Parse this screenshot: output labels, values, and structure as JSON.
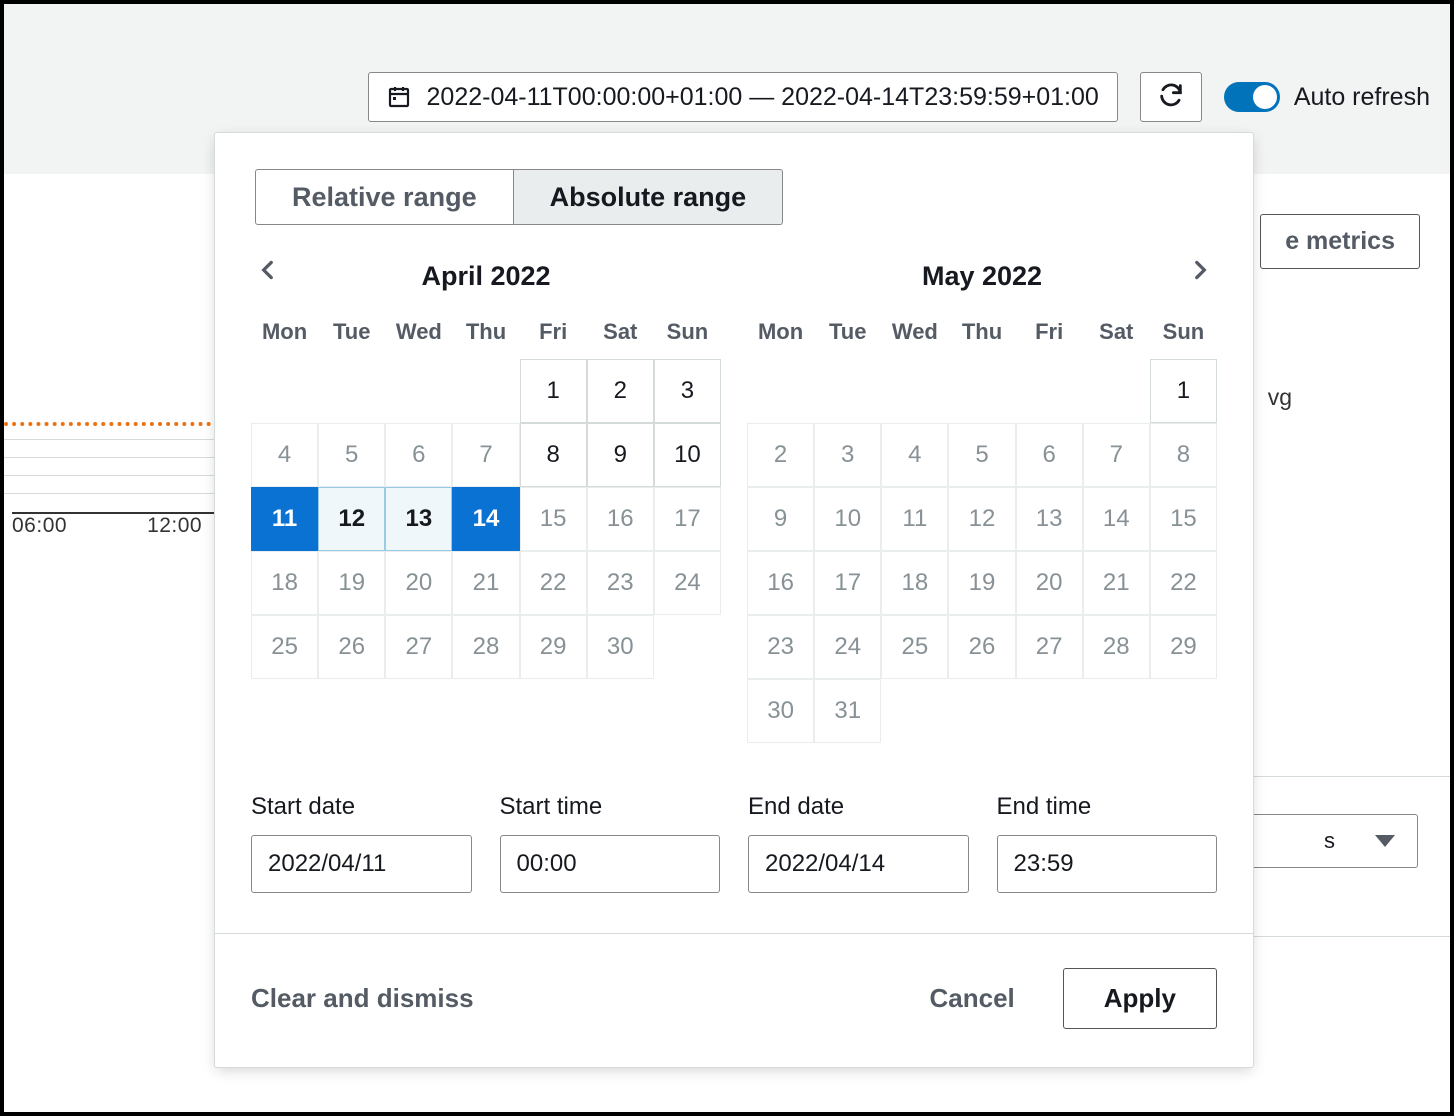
{
  "toolbar": {
    "range_text": "2022-04-11T00:00:00+01:00 — 2022-04-14T23:59:59+01:00",
    "auto_refresh_label": "Auto refresh",
    "auto_refresh_on": true
  },
  "background": {
    "metrics_button_partial_text": "e metrics",
    "chart_label_partial": "vg",
    "x_ticks": [
      "06:00",
      "12:00"
    ]
  },
  "popover": {
    "tabs": {
      "relative": "Relative range",
      "absolute": "Absolute range",
      "active": "absolute"
    },
    "months": [
      {
        "title": "April 2022",
        "weekdays": [
          "Mon",
          "Tue",
          "Wed",
          "Thu",
          "Fri",
          "Sat",
          "Sun"
        ],
        "leading_empty": 4,
        "days": [
          {
            "n": 1,
            "state": "boundary"
          },
          {
            "n": 2,
            "state": "boundary"
          },
          {
            "n": 3,
            "state": "boundary"
          },
          {
            "n": 4,
            "state": "dim"
          },
          {
            "n": 5,
            "state": "dim"
          },
          {
            "n": 6,
            "state": "dim"
          },
          {
            "n": 7,
            "state": "dim"
          },
          {
            "n": 8,
            "state": "boundary"
          },
          {
            "n": 9,
            "state": "boundary"
          },
          {
            "n": 10,
            "state": "boundary"
          },
          {
            "n": 11,
            "state": "sel-start"
          },
          {
            "n": 12,
            "state": "sel-range"
          },
          {
            "n": 13,
            "state": "sel-range"
          },
          {
            "n": 14,
            "state": "sel-end"
          },
          {
            "n": 15,
            "state": "dim"
          },
          {
            "n": 16,
            "state": "dim"
          },
          {
            "n": 17,
            "state": "dim"
          },
          {
            "n": 18,
            "state": "dim"
          },
          {
            "n": 19,
            "state": "dim"
          },
          {
            "n": 20,
            "state": "dim"
          },
          {
            "n": 21,
            "state": "dim"
          },
          {
            "n": 22,
            "state": "dim"
          },
          {
            "n": 23,
            "state": "dim"
          },
          {
            "n": 24,
            "state": "dim"
          },
          {
            "n": 25,
            "state": "dim"
          },
          {
            "n": 26,
            "state": "dim"
          },
          {
            "n": 27,
            "state": "dim"
          },
          {
            "n": 28,
            "state": "dim"
          },
          {
            "n": 29,
            "state": "dim"
          },
          {
            "n": 30,
            "state": "dim"
          }
        ]
      },
      {
        "title": "May 2022",
        "weekdays": [
          "Mon",
          "Tue",
          "Wed",
          "Thu",
          "Fri",
          "Sat",
          "Sun"
        ],
        "leading_empty": 6,
        "days": [
          {
            "n": 1,
            "state": "boundary"
          },
          {
            "n": 2,
            "state": "dim"
          },
          {
            "n": 3,
            "state": "dim"
          },
          {
            "n": 4,
            "state": "dim"
          },
          {
            "n": 5,
            "state": "dim"
          },
          {
            "n": 6,
            "state": "dim"
          },
          {
            "n": 7,
            "state": "dim"
          },
          {
            "n": 8,
            "state": "dim"
          },
          {
            "n": 9,
            "state": "dim"
          },
          {
            "n": 10,
            "state": "dim"
          },
          {
            "n": 11,
            "state": "dim"
          },
          {
            "n": 12,
            "state": "dim"
          },
          {
            "n": 13,
            "state": "dim"
          },
          {
            "n": 14,
            "state": "dim"
          },
          {
            "n": 15,
            "state": "dim"
          },
          {
            "n": 16,
            "state": "dim"
          },
          {
            "n": 17,
            "state": "dim"
          },
          {
            "n": 18,
            "state": "dim"
          },
          {
            "n": 19,
            "state": "dim"
          },
          {
            "n": 20,
            "state": "dim"
          },
          {
            "n": 21,
            "state": "dim"
          },
          {
            "n": 22,
            "state": "dim"
          },
          {
            "n": 23,
            "state": "dim"
          },
          {
            "n": 24,
            "state": "dim"
          },
          {
            "n": 25,
            "state": "dim"
          },
          {
            "n": 26,
            "state": "dim"
          },
          {
            "n": 27,
            "state": "dim"
          },
          {
            "n": 28,
            "state": "dim"
          },
          {
            "n": 29,
            "state": "dim"
          },
          {
            "n": 30,
            "state": "dim"
          },
          {
            "n": 31,
            "state": "dim"
          }
        ]
      }
    ],
    "inputs": {
      "start_date": {
        "label": "Start date",
        "value": "2022/04/11"
      },
      "start_time": {
        "label": "Start time",
        "value": "00:00"
      },
      "end_date": {
        "label": "End date",
        "value": "2022/04/14"
      },
      "end_time": {
        "label": "End time",
        "value": "23:59"
      }
    },
    "actions": {
      "clear": "Clear and dismiss",
      "cancel": "Cancel",
      "apply": "Apply"
    }
  }
}
